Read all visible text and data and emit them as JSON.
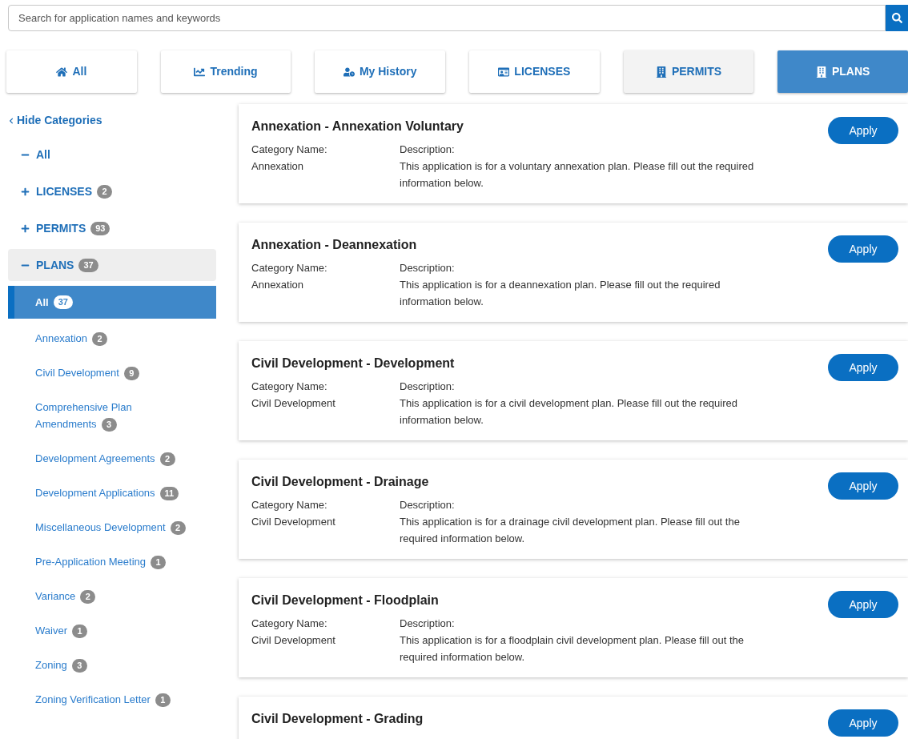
{
  "search": {
    "placeholder": "Search for application names and keywords"
  },
  "tabs": [
    {
      "label": "All",
      "selected": false,
      "hovered": false
    },
    {
      "label": "Trending",
      "selected": false,
      "hovered": false
    },
    {
      "label": "My History",
      "selected": false,
      "hovered": false
    },
    {
      "label": "LICENSES",
      "selected": false,
      "hovered": false
    },
    {
      "label": "PERMITS",
      "selected": false,
      "hovered": true
    },
    {
      "label": "PLANS",
      "selected": true,
      "hovered": false
    }
  ],
  "sidebar": {
    "toggle": "Hide Categories",
    "items": [
      {
        "label": "All",
        "expanded": true,
        "selected": false
      },
      {
        "label": "LICENSES",
        "count": "2",
        "expanded": false,
        "selected": false
      },
      {
        "label": "PERMITS",
        "count": "93",
        "expanded": false,
        "selected": false
      },
      {
        "label": "PLANS",
        "count": "37",
        "expanded": true,
        "selected": true,
        "children": [
          {
            "label": "All",
            "count": "37",
            "selected": true
          },
          {
            "label": "Annexation",
            "count": "2",
            "selected": false
          },
          {
            "label": "Civil Development",
            "count": "9",
            "selected": false
          },
          {
            "label": "Comprehensive Plan Amendments",
            "count": "3",
            "selected": false
          },
          {
            "label": "Development Agreements",
            "count": "2",
            "selected": false
          },
          {
            "label": "Development Applications",
            "count": "11",
            "selected": false
          },
          {
            "label": "Miscellaneous Development",
            "count": "2",
            "selected": false
          },
          {
            "label": "Pre-Application Meeting",
            "count": "1",
            "selected": false
          },
          {
            "label": "Variance",
            "count": "2",
            "selected": false
          },
          {
            "label": "Waiver",
            "count": "1",
            "selected": false
          },
          {
            "label": "Zoning",
            "count": "3",
            "selected": false
          },
          {
            "label": "Zoning Verification Letter",
            "count": "1",
            "selected": false
          }
        ]
      }
    ]
  },
  "applications": [
    {
      "title": "Annexation - Annexation Voluntary",
      "category_label": "Category Name:",
      "category": "Annexation",
      "description_label": "Description:",
      "description": "This application is for a voluntary annexation plan. Please fill out the required information below.",
      "button": "Apply"
    },
    {
      "title": "Annexation - Deannexation",
      "category_label": "Category Name:",
      "category": "Annexation",
      "description_label": "Description:",
      "description": "This application is for a deannexation plan. Please fill out the required information below.",
      "button": "Apply"
    },
    {
      "title": "Civil Development - Development",
      "category_label": "Category Name:",
      "category": "Civil Development",
      "description_label": "Description:",
      "description": "This application is for a civil development plan. Please fill out the required information below.",
      "button": "Apply"
    },
    {
      "title": "Civil Development - Drainage",
      "category_label": "Category Name:",
      "category": "Civil Development",
      "description_label": "Description:",
      "description": "This application is for a drainage civil development plan. Please fill out the required information below.",
      "button": "Apply"
    },
    {
      "title": "Civil Development - Floodplain",
      "category_label": "Category Name:",
      "category": "Civil Development",
      "description_label": "Description:",
      "description": "This application is for a floodplain civil development plan. Please fill out the required information below.",
      "button": "Apply"
    },
    {
      "title": "Civil Development - Grading",
      "button": "Apply"
    }
  ]
}
